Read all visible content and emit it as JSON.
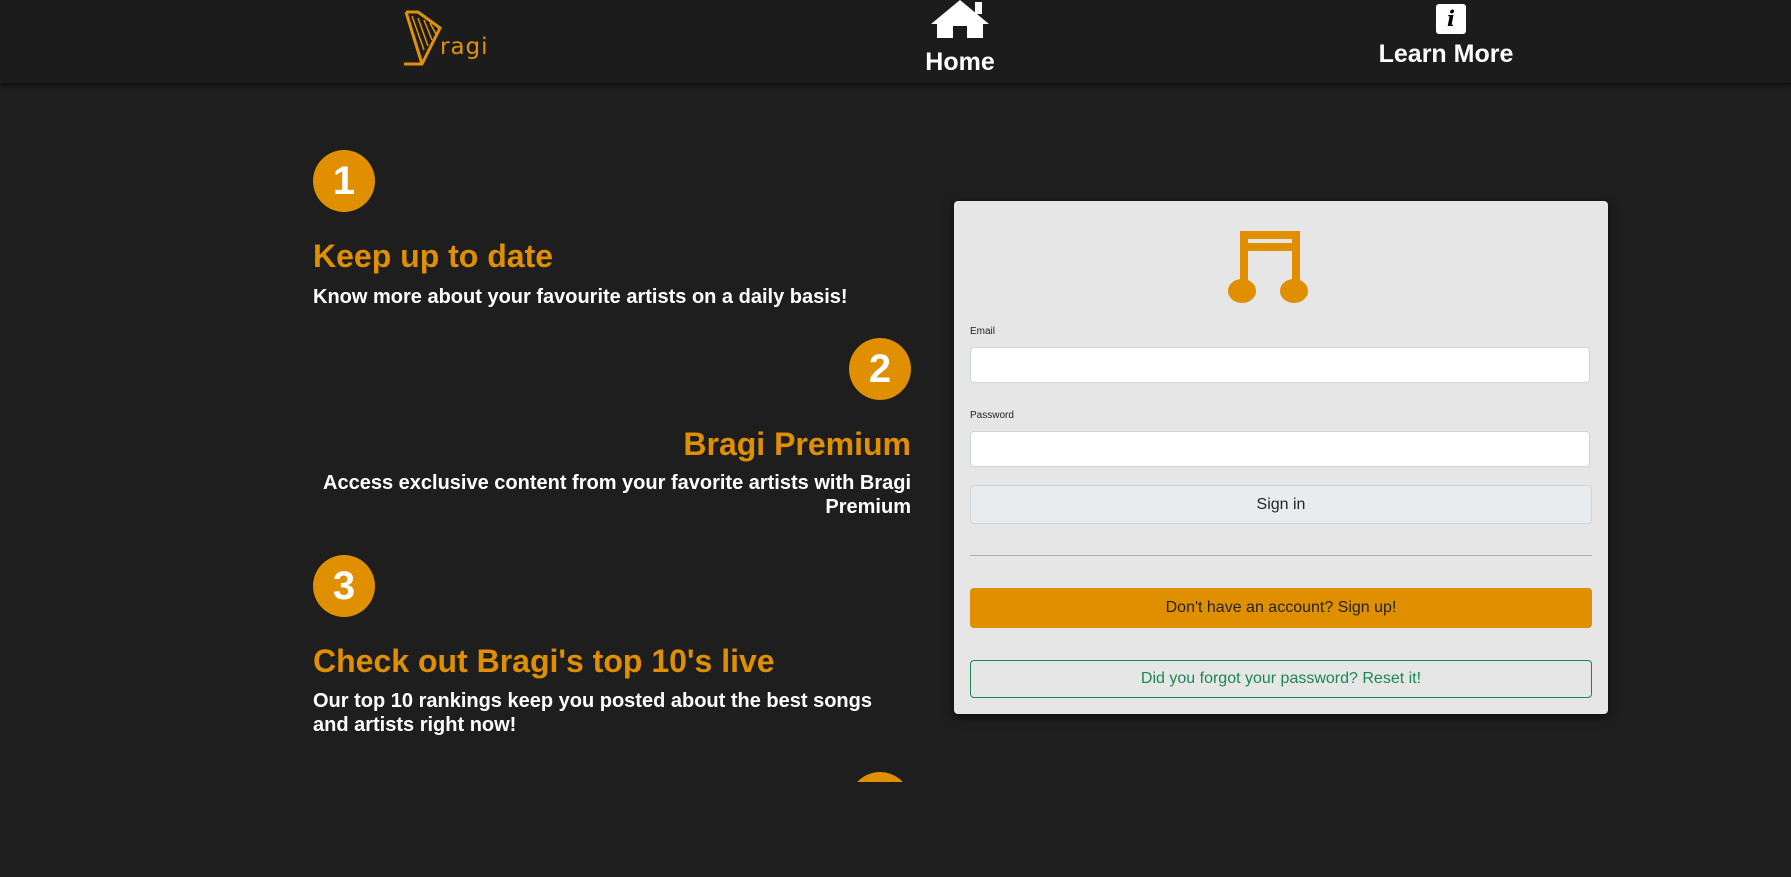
{
  "nav": {
    "logo_text": "ragi",
    "home_label": "Home",
    "learn_more_label": "Learn More",
    "learn_more_icon_glyph": "i"
  },
  "features": [
    {
      "number": "1",
      "title": "Keep up to date",
      "description": "Know more about your favourite artists on a daily basis!"
    },
    {
      "number": "2",
      "title": "Bragi Premium",
      "description": "Access exclusive content from your favorite artists with Bragi Premium"
    },
    {
      "number": "3",
      "title": "Check out Bragi's top 10's live",
      "description": "Our top 10 rankings keep you posted about the best songs and artists right now!"
    }
  ],
  "login": {
    "email_label": "Email",
    "email_value": "",
    "password_label": "Password",
    "password_value": "",
    "signin_label": "Sign in",
    "signup_label": "Don't have an account? Sign up!",
    "reset_label": "Did you forgot your password? Reset it!"
  },
  "colors": {
    "accent": "#df8f00",
    "background": "#1e1e1e",
    "card": "#e6e6e6",
    "reset_green": "#198754"
  }
}
